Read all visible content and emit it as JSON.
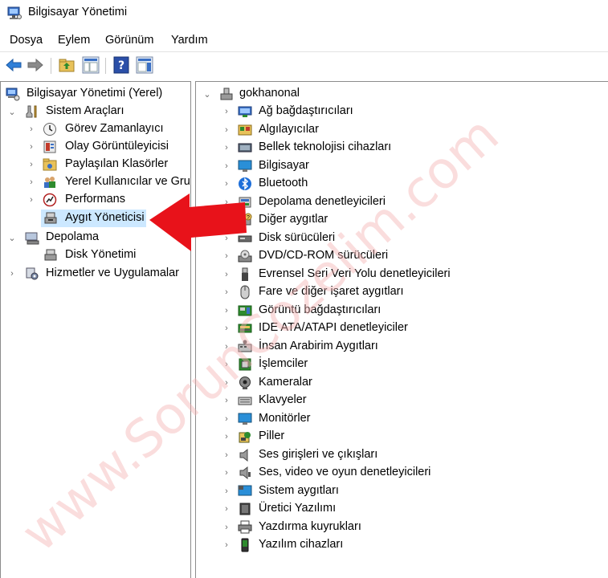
{
  "window": {
    "title": "Bilgisayar Yönetimi"
  },
  "menu": [
    {
      "label": "Dosya"
    },
    {
      "label": "Eylem"
    },
    {
      "label": "Görünüm"
    },
    {
      "label": "Yardım"
    }
  ],
  "left_tree": {
    "root": "Bilgisayar Yönetimi (Yerel)",
    "system_tools": "Sistem Araçları",
    "system_children": [
      {
        "label": "Görev Zamanlayıcı",
        "icon": "clock-icon"
      },
      {
        "label": "Olay Görüntüleyicisi",
        "icon": "event-viewer-icon"
      },
      {
        "label": "Paylaşılan Klasörler",
        "icon": "shared-folder-icon"
      },
      {
        "label": "Yerel Kullanıcılar ve Grup",
        "icon": "users-icon"
      },
      {
        "label": "Performans",
        "icon": "performance-icon"
      },
      {
        "label": "Aygıt Yöneticisi",
        "icon": "device-manager-icon"
      }
    ],
    "storage": "Depolama",
    "storage_children": [
      {
        "label": "Disk Yönetimi",
        "icon": "disk-management-icon"
      }
    ],
    "services": "Hizmetler ve Uygulamalar"
  },
  "device_tree": {
    "root": "gokhanonal",
    "categories": [
      {
        "label": "Ağ bağdaştırıcıları",
        "icon": "network-adapter-icon"
      },
      {
        "label": "Algılayıcılar",
        "icon": "sensor-icon"
      },
      {
        "label": "Bellek teknolojisi cihazları",
        "icon": "memory-device-icon"
      },
      {
        "label": "Bilgisayar",
        "icon": "computer-icon"
      },
      {
        "label": "Bluetooth",
        "icon": "bluetooth-icon"
      },
      {
        "label": "Depolama denetleyicileri",
        "icon": "storage-controller-icon"
      },
      {
        "label": "Diğer aygıtlar",
        "icon": "other-devices-icon"
      },
      {
        "label": "Disk sürücüleri",
        "icon": "disk-drive-icon"
      },
      {
        "label": "DVD/CD-ROM sürücüleri",
        "icon": "dvd-drive-icon"
      },
      {
        "label": "Evrensel Seri Veri Yolu denetleyicileri",
        "icon": "usb-icon"
      },
      {
        "label": "Fare ve diğer işaret aygıtları",
        "icon": "mouse-icon"
      },
      {
        "label": "Görüntü bağdaştırıcıları",
        "icon": "display-adapter-icon"
      },
      {
        "label": "IDE ATA/ATAPI denetleyiciler",
        "icon": "ide-controller-icon"
      },
      {
        "label": "İnsan Arabirim Aygıtları",
        "icon": "hid-icon"
      },
      {
        "label": "İşlemciler",
        "icon": "processor-icon"
      },
      {
        "label": "Kameralar",
        "icon": "camera-icon"
      },
      {
        "label": "Klavyeler",
        "icon": "keyboard-icon"
      },
      {
        "label": "Monitörler",
        "icon": "monitor-icon"
      },
      {
        "label": "Piller",
        "icon": "battery-icon"
      },
      {
        "label": "Ses girişleri ve çıkışları",
        "icon": "speaker-icon"
      },
      {
        "label": "Ses, video ve oyun denetleyicileri",
        "icon": "sound-controller-icon"
      },
      {
        "label": "Sistem aygıtları",
        "icon": "system-devices-icon"
      },
      {
        "label": "Üretici Yazılımı",
        "icon": "firmware-icon"
      },
      {
        "label": "Yazdırma kuyrukları",
        "icon": "printer-icon"
      },
      {
        "label": "Yazılım cihazları",
        "icon": "software-device-icon"
      }
    ]
  },
  "colors": {
    "selection": "#cce8ff",
    "arrow": "#e8121a",
    "watermark": "#f4b3b3"
  },
  "watermark": "www.SorunCozelim.com"
}
